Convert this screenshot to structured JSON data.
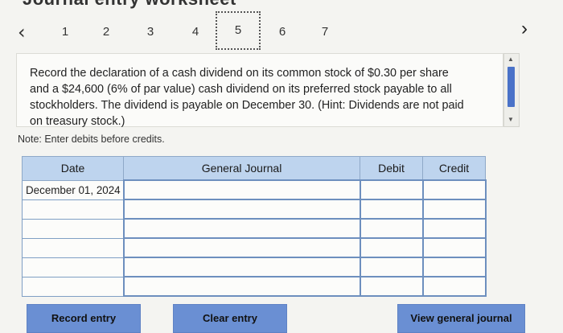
{
  "header": {
    "title_partial": "Journal entry worksheet"
  },
  "pager": {
    "prev_icon": "‹",
    "pages": [
      "1",
      "2",
      "3",
      "4",
      "5",
      "6",
      "7"
    ],
    "active_page": "5",
    "next_icon": "›"
  },
  "question": {
    "text": "Record the declaration of a cash dividend on its common stock of $0.30 per share and a $24,600 (6% of par value) cash dividend on its preferred stock payable to all stockholders. The dividend is payable on December 30. (Hint: Dividends are not paid on treasury stock.)"
  },
  "note": "Note: Enter debits before credits.",
  "journal": {
    "headers": [
      "Date",
      "General Journal",
      "Debit",
      "Credit"
    ],
    "rows": [
      [
        "December 01, 2024",
        "",
        "",
        ""
      ],
      [
        "",
        "",
        "",
        ""
      ],
      [
        "",
        "",
        "",
        ""
      ],
      [
        "",
        "",
        "",
        ""
      ],
      [
        "",
        "",
        "",
        ""
      ],
      [
        "",
        "",
        "",
        ""
      ]
    ]
  },
  "buttons": {
    "record_entry": "Record entry",
    "clear_entry": "Clear entry",
    "view_general_journal": "View general journal"
  },
  "colors": {
    "header_bg": "#bed4ee",
    "button_bg": "#6a8fd3",
    "scroll_thumb": "#4a72c8"
  }
}
